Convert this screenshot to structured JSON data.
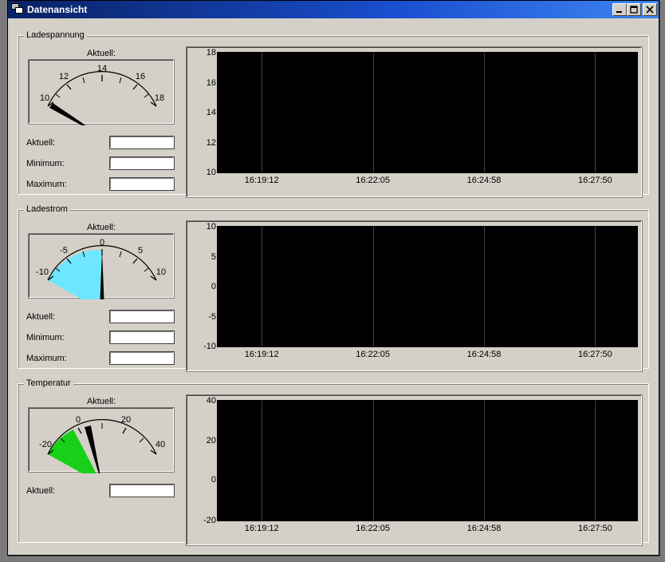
{
  "window": {
    "title": "Datenansicht"
  },
  "panels": {
    "ladespannung": {
      "legend": "Ladespannung",
      "gauge_caption": "Aktuell:",
      "ticks": [
        "10",
        "12",
        "14",
        "16",
        "18"
      ],
      "fields": {
        "aktuell_label": "Aktuell:",
        "aktuell_value": "",
        "minimum_label": "Minimum:",
        "minimum_value": "",
        "maximum_label": "Maximum:",
        "maximum_value": ""
      },
      "chart": {
        "y_ticks": [
          "18",
          "16",
          "14",
          "12",
          "10"
        ],
        "x_ticks": [
          "16:19:12",
          "16:22:05",
          "16:24:58",
          "16:27:50"
        ]
      }
    },
    "ladestrom": {
      "legend": "Ladestrom",
      "gauge_caption": "Aktuell:",
      "ticks": [
        "-10",
        "-5",
        "0",
        "5",
        "10"
      ],
      "fields": {
        "aktuell_label": "Aktuell:",
        "aktuell_value": "",
        "minimum_label": "Minimum:",
        "minimum_value": "",
        "maximum_label": "Maximum:",
        "maximum_value": ""
      },
      "chart": {
        "y_ticks": [
          "10",
          "5",
          "0",
          "-5",
          "-10"
        ],
        "x_ticks": [
          "16:19:12",
          "16:22:05",
          "16:24:58",
          "16:27:50"
        ]
      }
    },
    "temperatur": {
      "legend": "Temperatur",
      "gauge_caption": "Aktuell:",
      "ticks": [
        "-20",
        "0",
        "20",
        "40"
      ],
      "fields": {
        "aktuell_label": "Aktuell:",
        "aktuell_value": ""
      },
      "chart": {
        "y_ticks": [
          "40",
          "20",
          "0",
          "-20"
        ],
        "x_ticks": [
          "16:19:12",
          "16:22:05",
          "16:24:58",
          "16:27:50"
        ]
      }
    }
  },
  "chart_data": [
    {
      "type": "line",
      "title": "Ladespannung",
      "xlabel": "",
      "ylabel": "",
      "ylim": [
        10,
        18
      ],
      "x_ticks": [
        "16:19:12",
        "16:22:05",
        "16:24:58",
        "16:27:50"
      ],
      "series": [
        {
          "name": "Ladespannung",
          "values": []
        }
      ]
    },
    {
      "type": "line",
      "title": "Ladestrom",
      "xlabel": "",
      "ylabel": "",
      "ylim": [
        -10,
        10
      ],
      "x_ticks": [
        "16:19:12",
        "16:22:05",
        "16:24:58",
        "16:27:50"
      ],
      "series": [
        {
          "name": "Ladestrom",
          "values": []
        }
      ]
    },
    {
      "type": "line",
      "title": "Temperatur",
      "xlabel": "",
      "ylabel": "",
      "ylim": [
        -20,
        40
      ],
      "x_ticks": [
        "16:19:12",
        "16:22:05",
        "16:24:58",
        "16:27:50"
      ],
      "series": [
        {
          "name": "Temperatur",
          "values": []
        }
      ]
    }
  ]
}
